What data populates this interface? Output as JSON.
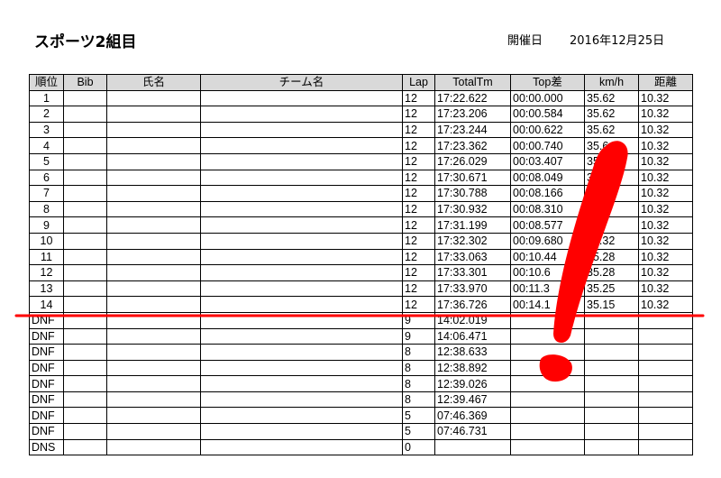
{
  "header": {
    "title": "スポーツ2組目",
    "date_label": "開催日",
    "date_value": "2016年12月25日"
  },
  "table": {
    "columns": [
      "順位",
      "Bib",
      "氏名",
      "チーム名",
      "Lap",
      "TotalTm",
      "Top差",
      "km/h",
      "距離"
    ],
    "rows": [
      {
        "rank": "1",
        "lap": "12",
        "total": "17:22.622",
        "top": "00:00.000",
        "kmh": "35.62",
        "dist": "10.32"
      },
      {
        "rank": "2",
        "lap": "12",
        "total": "17:23.206",
        "top": "00:00.584",
        "kmh": "35.62",
        "dist": "10.32"
      },
      {
        "rank": "3",
        "lap": "12",
        "total": "17:23.244",
        "top": "00:00.622",
        "kmh": "35.62",
        "dist": "10.32"
      },
      {
        "rank": "4",
        "lap": "12",
        "total": "17:23.362",
        "top": "00:00.740",
        "kmh": "35.6",
        "dist": "10.32"
      },
      {
        "rank": "5",
        "lap": "12",
        "total": "17:26.029",
        "top": "00:03.407",
        "kmh": "35.",
        "dist": "10.32"
      },
      {
        "rank": "6",
        "lap": "12",
        "total": "17:30.671",
        "top": "00:08.049",
        "kmh": "35.",
        "dist": "10.32"
      },
      {
        "rank": "7",
        "lap": "12",
        "total": "17:30.788",
        "top": "00:08.166",
        "kmh": "35",
        "dist": "10.32"
      },
      {
        "rank": "8",
        "lap": "12",
        "total": "17:30.932",
        "top": "00:08.310",
        "kmh": "35",
        "dist": "10.32"
      },
      {
        "rank": "9",
        "lap": "12",
        "total": "17:31.199",
        "top": "00:08.577",
        "kmh": "35",
        "dist": "10.32"
      },
      {
        "rank": "10",
        "lap": "12",
        "total": "17:32.302",
        "top": "00:09.680",
        "kmh": "35.32",
        "dist": "10.32"
      },
      {
        "rank": "11",
        "lap": "12",
        "total": "17:33.063",
        "top": "00:10.44",
        "kmh": "35.28",
        "dist": "10.32"
      },
      {
        "rank": "12",
        "lap": "12",
        "total": "17:33.301",
        "top": "00:10.6",
        "kmh": "35.28",
        "dist": "10.32"
      },
      {
        "rank": "13",
        "lap": "12",
        "total": "17:33.970",
        "top": "00:11.3",
        "kmh": "35.25",
        "dist": "10.32"
      },
      {
        "rank": "14",
        "lap": "12",
        "total": "17:36.726",
        "top": "00:14.1",
        "kmh": "35.15",
        "dist": "10.32"
      },
      {
        "rank": "DNF",
        "lap": "9",
        "total": "14:02.019",
        "top": "",
        "kmh": "",
        "dist": ""
      },
      {
        "rank": "DNF",
        "lap": "9",
        "total": "14:06.471",
        "top": "",
        "kmh": "",
        "dist": ""
      },
      {
        "rank": "DNF",
        "lap": "8",
        "total": "12:38.633",
        "top": "",
        "kmh": "",
        "dist": ""
      },
      {
        "rank": "DNF",
        "lap": "8",
        "total": "12:38.892",
        "top": "",
        "kmh": "",
        "dist": ""
      },
      {
        "rank": "DNF",
        "lap": "8",
        "total": "12:39.026",
        "top": "",
        "kmh": "",
        "dist": ""
      },
      {
        "rank": "DNF",
        "lap": "8",
        "total": "12:39.467",
        "top": "",
        "kmh": "",
        "dist": ""
      },
      {
        "rank": "DNF",
        "lap": "5",
        "total": "07:46.369",
        "top": "",
        "kmh": "",
        "dist": ""
      },
      {
        "rank": "DNF",
        "lap": "5",
        "total": "07:46.731",
        "top": "",
        "kmh": "",
        "dist": ""
      },
      {
        "rank": "DNS",
        "lap": "0",
        "total": "",
        "top": "",
        "kmh": "",
        "dist": ""
      }
    ]
  },
  "annotation": {
    "cutoff_line_color": "#ff0000",
    "mark": "exclamation-mark",
    "mark_color": "#ff0000"
  }
}
